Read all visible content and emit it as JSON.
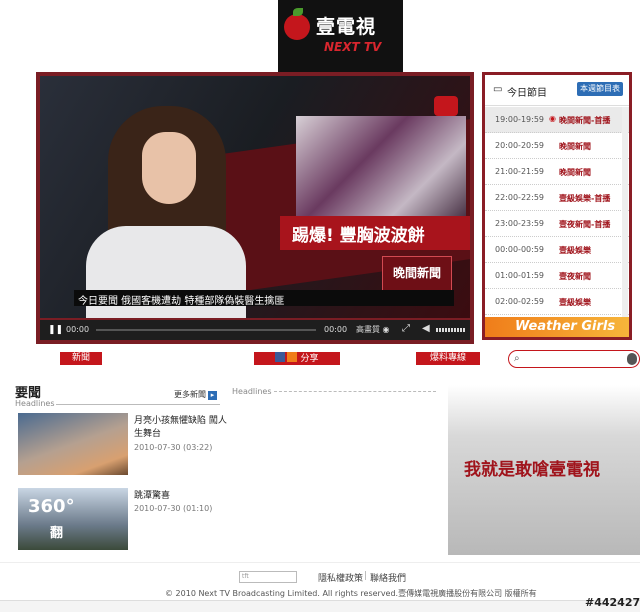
{
  "logo": {
    "chinese": "壹電視",
    "english": "NEXT TV"
  },
  "player": {
    "banner_text": "踢爆! 豐胸波波餅",
    "badge_text": "晚間新聞",
    "ticker": "今日要聞  俄國客機遭劫 特種部隊偽裝醫生擒匪",
    "time_current": "00:00",
    "time_total": "00:00",
    "quality_label": "高畫質"
  },
  "schedule": {
    "title": "今日節目",
    "week_button": "本週節目表",
    "rows": [
      {
        "time": "19:00-19:59",
        "program": "晚間新聞-首播",
        "active": true
      },
      {
        "time": "20:00-20:59",
        "program": "晚間新聞"
      },
      {
        "time": "21:00-21:59",
        "program": "晚間新聞"
      },
      {
        "time": "22:00-22:59",
        "program": "壹級娛樂-首播"
      },
      {
        "time": "23:00-23:59",
        "program": "壹夜新聞-首播"
      },
      {
        "time": "00:00-00:59",
        "program": "壹級娛樂"
      },
      {
        "time": "01:00-01:59",
        "program": "壹夜新聞"
      },
      {
        "time": "02:00-02:59",
        "program": "壹級娛樂"
      }
    ],
    "weather_label": "Weather Girls"
  },
  "nav": {
    "news": "新聞",
    "share": "分享",
    "tips": "爆料專線"
  },
  "headlines": {
    "title": "要聞",
    "title_en": "Headlines",
    "more": "更多新聞",
    "section2_en": "Headlines",
    "stories": [
      {
        "headline": "月亮小孩無懼缺陷 闖人生舞台",
        "date": "2010-07-30 (03:22)"
      },
      {
        "headline": "跳潭驚喜",
        "date": "2010-07-30 (01:10)",
        "thumb_big": "360°",
        "thumb_small": "翻"
      }
    ]
  },
  "ad": {
    "text": "我就是敢嗆壹電視"
  },
  "footer": {
    "box_text": "tft",
    "privacy": "隱私權政策",
    "separator": "|",
    "contact": "聯絡我們",
    "copyright": "© 2010 Next TV Broadcasting Limited. All rights reserved.壹傳媒電視廣播股份有限公司 版權所有"
  },
  "watermark": "#442427"
}
